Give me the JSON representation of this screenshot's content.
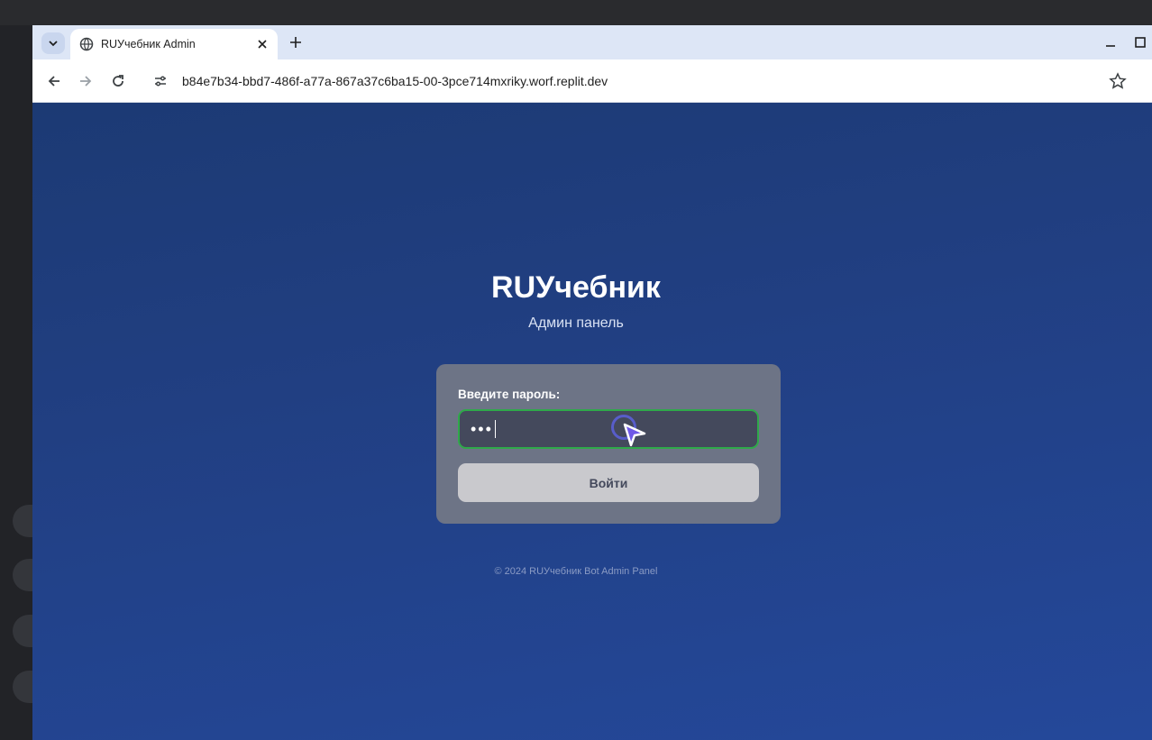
{
  "browser": {
    "tab_title": "RUУчебник Admin",
    "url": "b84e7b34-bbd7-486f-a77a-867a37c6ba15-00-3pce714mxriky.worf.replit.dev"
  },
  "page": {
    "brand_title": "RUУчебник",
    "brand_subtitle": "Админ панель",
    "password_label": "Введите пароль:",
    "password_value": "•••",
    "login_button": "Войти",
    "footer": "© 2024 RUУчебник Bot Admin Panel"
  },
  "colors": {
    "page_bg": "#213f82",
    "card_bg": "#6d7486",
    "input_border": "#2fa94a",
    "button_bg": "#c9c9cd",
    "cursor": "#5b5fd6"
  },
  "icons": [
    "tab-search-icon",
    "globe-icon",
    "close-icon",
    "plus-icon",
    "minimize-icon",
    "maximize-icon",
    "back-icon",
    "forward-icon",
    "reload-icon",
    "site-info-icon",
    "star-icon",
    "pointer-cursor-icon"
  ]
}
